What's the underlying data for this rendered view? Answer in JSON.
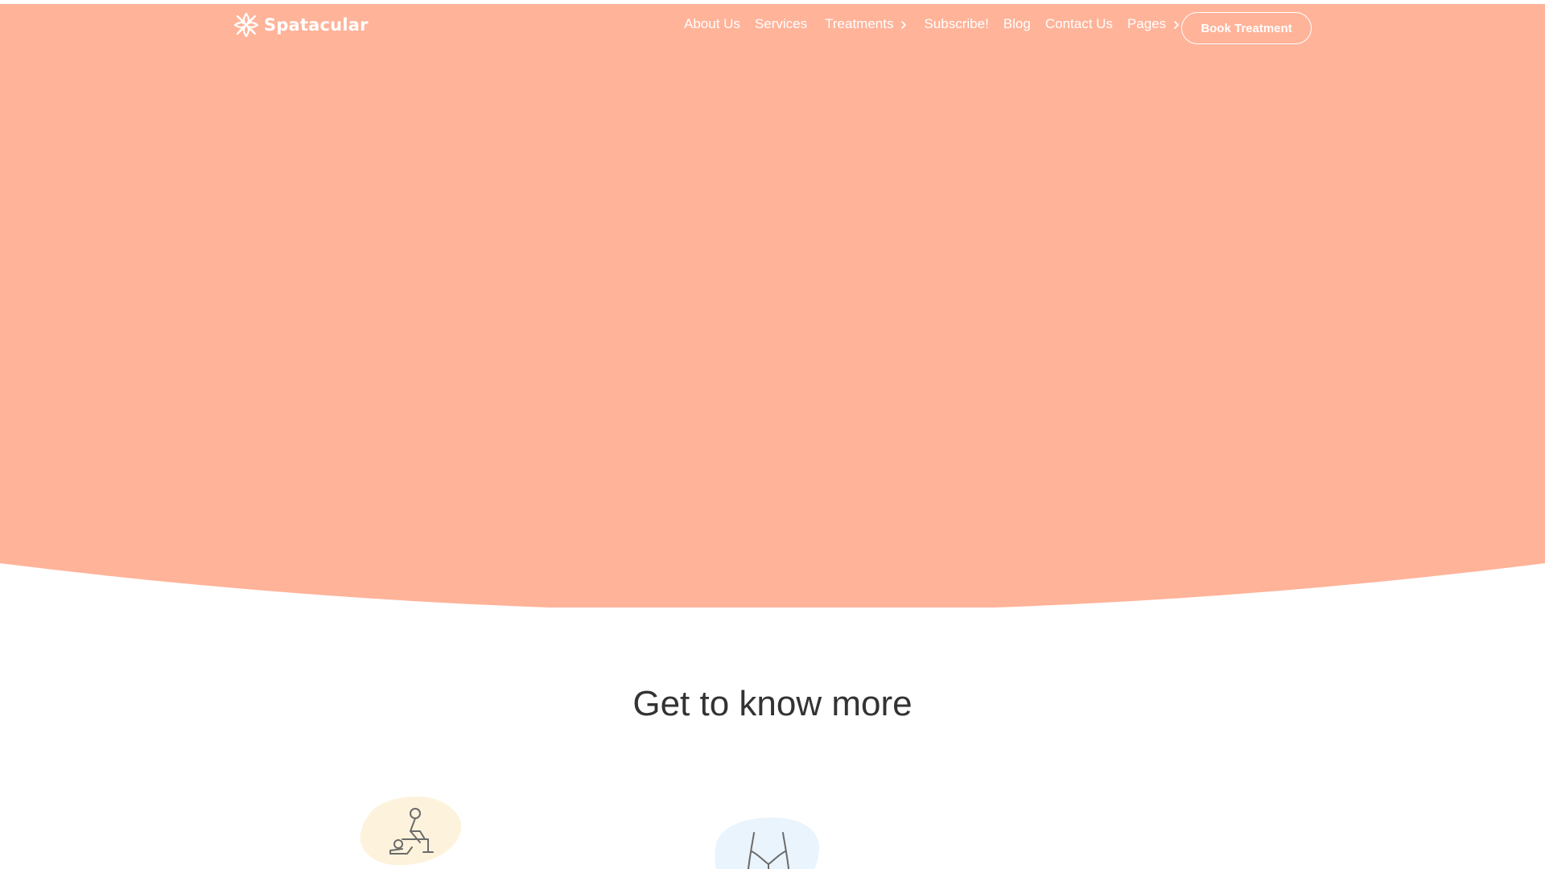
{
  "brand": {
    "name": "Spatacular",
    "logo_icon": "flower-logo-icon"
  },
  "nav": {
    "items": [
      {
        "label": "About Us",
        "has_chevron": false
      },
      {
        "label": "Services",
        "has_chevron": false
      },
      {
        "label": "Treatments",
        "has_chevron": true
      },
      {
        "label": "Subscribe!",
        "has_chevron": false
      },
      {
        "label": "Blog",
        "has_chevron": false
      },
      {
        "label": "Contact Us",
        "has_chevron": false
      },
      {
        "label": "Pages",
        "has_chevron": true
      }
    ],
    "cta_label": "Book Treatment"
  },
  "section": {
    "title": "Get to know more"
  },
  "features": [
    {
      "icon": "massage-icon",
      "blob_color": "#fdf3dc"
    },
    {
      "icon": "body-contour-icon",
      "blob_color": "#e9f4fc"
    }
  ],
  "colors": {
    "hero_background": "#ffb399",
    "page_background": "#ffffff",
    "nav_text": "#ffffff",
    "heading_text": "#333333",
    "icon_stroke": "#6b6b6b"
  }
}
